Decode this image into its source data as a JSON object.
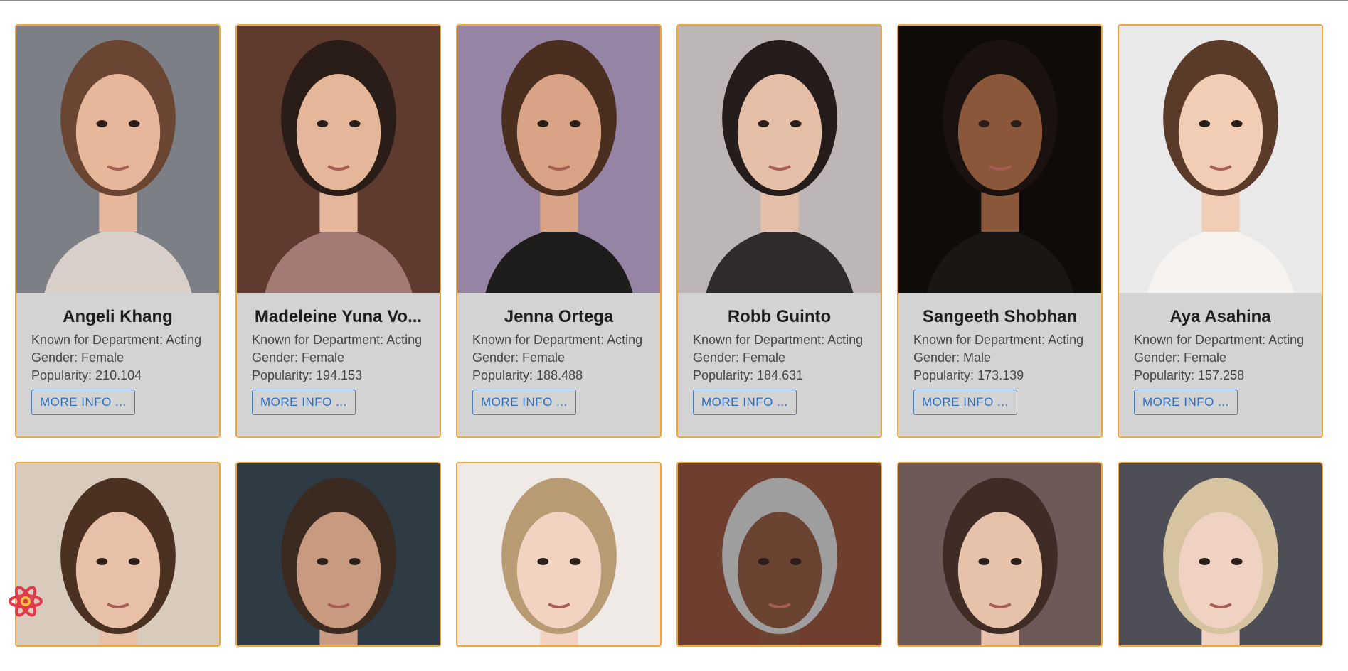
{
  "labels": {
    "department_prefix": "Known for Department: ",
    "gender_prefix": "Gender: ",
    "popularity_prefix": "Popularity: ",
    "more_info": "MORE INFO ..."
  },
  "people": [
    {
      "name": "Angeli Khang",
      "department": "Acting",
      "gender": "Female",
      "popularity": "210.104",
      "bg": "#7d7f86",
      "skin": "#e6b79b",
      "hair": "#6a4632",
      "shirt": "#d8cfc9"
    },
    {
      "name": "Madeleine Yuna Vo...",
      "department": "Acting",
      "gender": "Female",
      "popularity": "194.153",
      "bg": "#5e3a2f",
      "skin": "#e5b79a",
      "hair": "#2a1c16",
      "shirt": "#a47a74"
    },
    {
      "name": "Jenna Ortega",
      "department": "Acting",
      "gender": "Female",
      "popularity": "188.488",
      "bg": "#9584a3",
      "skin": "#d9a385",
      "hair": "#4a2e20",
      "shirt": "#1f1c1c"
    },
    {
      "name": "Robb Guinto",
      "department": "Acting",
      "gender": "Female",
      "popularity": "184.631",
      "bg": "#bdb6b6",
      "skin": "#e5bfa7",
      "hair": "#241d1c",
      "shirt": "#2f2b2b"
    },
    {
      "name": "Sangeeth Shobhan",
      "department": "Acting",
      "gender": "Male",
      "popularity": "173.139",
      "bg": "#0e0b09",
      "skin": "#8a573b",
      "hair": "#1a120e",
      "shirt": "#1a1613"
    },
    {
      "name": "Aya Asahina",
      "department": "Acting",
      "gender": "Female",
      "popularity": "157.258",
      "bg": "#e9e9ea",
      "skin": "#f1cdb6",
      "hair": "#5a3a28",
      "shirt": "#f5f2ef"
    }
  ],
  "row2": [
    {
      "bg": "#d9cbbb",
      "skin": "#e8c0a8",
      "hair": "#4a3122",
      "shirt": "#e8c0a8"
    },
    {
      "bg": "#2e3a44",
      "skin": "#c89a7f",
      "hair": "#3b2a20",
      "shirt": "#1a1a1a"
    },
    {
      "bg": "#efeae6",
      "skin": "#f2d2c0",
      "hair": "#b89a73",
      "shirt": "#f2d2c0"
    },
    {
      "bg": "#6e3f2f",
      "skin": "#6a4331",
      "hair": "#9e9e9e",
      "shirt": "#2a3c7a"
    },
    {
      "bg": "#6d5a58",
      "skin": "#e6c2ab",
      "hair": "#3f2c24",
      "shirt": "#e6c2ab"
    },
    {
      "bg": "#4d4e56",
      "skin": "#f0d2c2",
      "hair": "#d6c3a0",
      "shirt": "#f0d2c2"
    }
  ]
}
